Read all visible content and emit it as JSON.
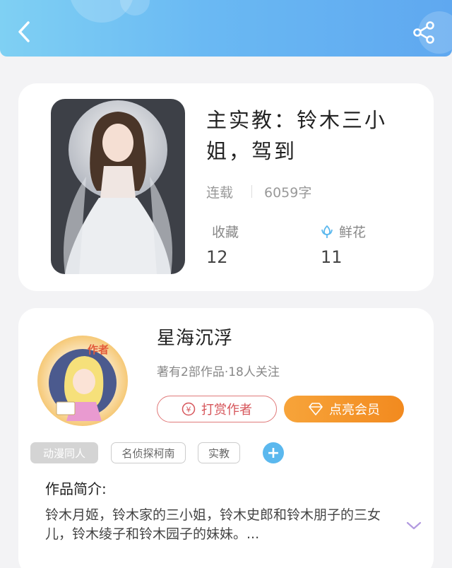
{
  "header": {
    "back_icon": "chevron-left-icon",
    "share_icon": "share-icon"
  },
  "book": {
    "cover_desc": "anime-girl-cover",
    "title": "主实教：铃木三小姐，驾到",
    "status": "连载",
    "word_count": "6059字",
    "stats": [
      {
        "label": "收藏",
        "value": "12",
        "icon": ""
      },
      {
        "label": "鲜花",
        "value": "11",
        "icon": "flower-icon"
      }
    ]
  },
  "author": {
    "name": "星海沉浮",
    "avatar_badge": "作者",
    "meta": "著有2部作品·18人关注",
    "tip_label": "打赏作者",
    "vip_label": "点亮会员"
  },
  "tags": [
    "动漫同人",
    "名侦探柯南",
    "实教"
  ],
  "add_tag_label": "+",
  "intro": {
    "heading": "作品简介:",
    "text": "铃木月姬，铃木家的三小姐，铃木史郎和铃木朋子的三女儿，铃木绫子和铃木园子的妹妹。..."
  },
  "colors": {
    "accent": "#5fa8f0",
    "tip": "#d6555a",
    "vip": "#f28a1f"
  }
}
